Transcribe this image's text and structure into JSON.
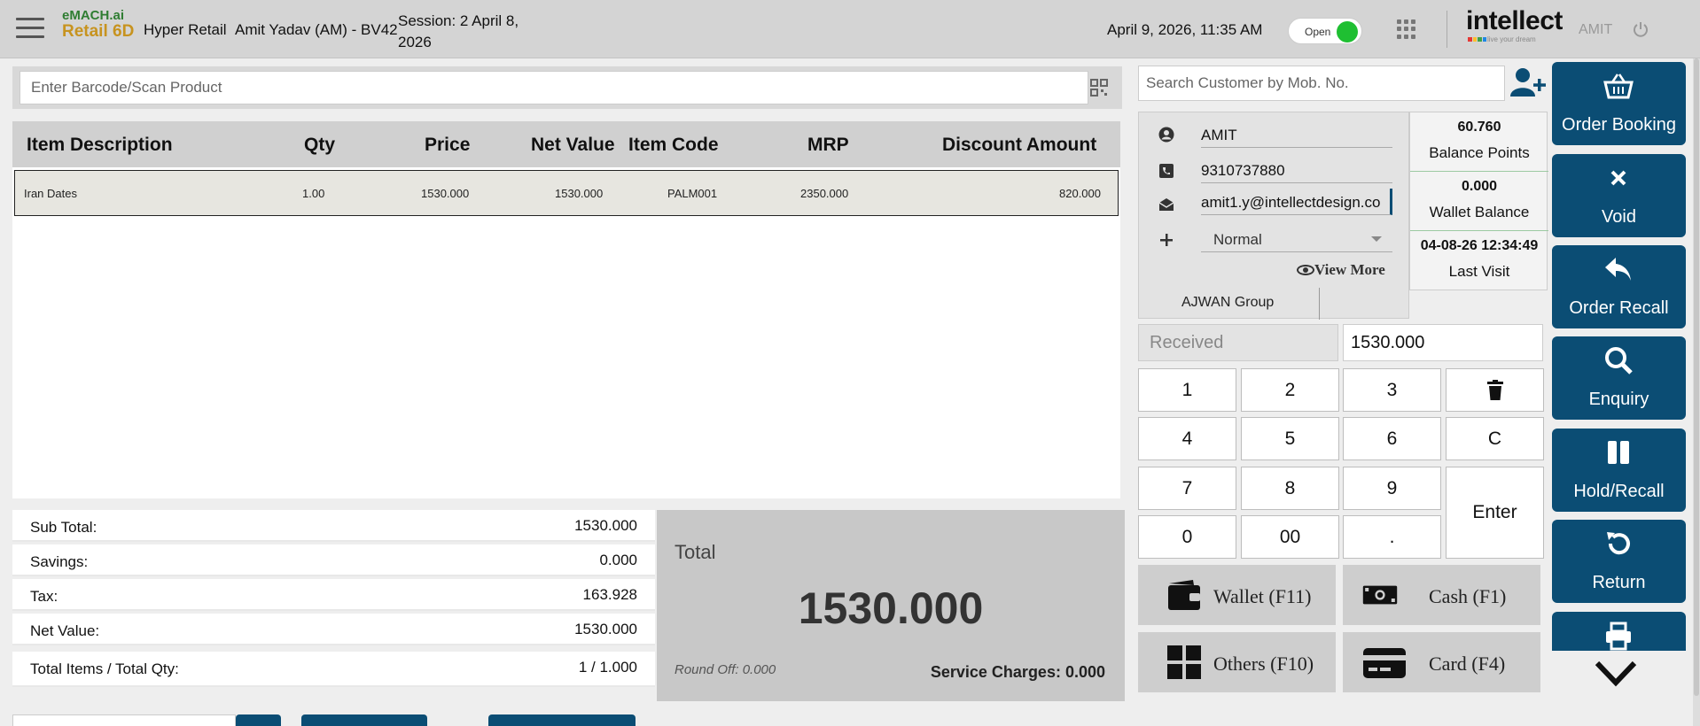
{
  "header": {
    "logo_top": "eMACH.ai",
    "logo_bottom": "Retail 6D",
    "store": "Hyper Retail",
    "user": "Amit Yadav (AM) - BV42",
    "session_line1": "Session: 2 April 8,",
    "session_line2": "2026",
    "datetime": "April 9, 2026, 11:35 AM",
    "toggle_label": "Open",
    "brand": "intellect",
    "brand_tagline": "live your dream",
    "user_short": "AMIT",
    "accent_green": "#1fbf32"
  },
  "scan": {
    "placeholder": "Enter Barcode/Scan Product"
  },
  "grid": {
    "headers": [
      "Item Description",
      "Qty",
      "Price",
      "Net Value",
      "Item Code",
      "MRP",
      "Discount Amount"
    ],
    "rows": [
      {
        "description": "Iran Dates",
        "qty": "1.00",
        "price": "1530.000",
        "net_value": "1530.000",
        "item_code": "PALM001",
        "mrp": "2350.000",
        "discount": "820.000"
      }
    ]
  },
  "totals": {
    "sub_total_label": "Sub Total:",
    "sub_total": "1530.000",
    "savings_label": "Savings:",
    "savings": "0.000",
    "tax_label": "Tax:",
    "tax": "163.928",
    "net_value_label": "Net Value:",
    "net_value": "1530.000",
    "items_label": "Total Items / Total Qty:",
    "items": "1 / 1.000",
    "total_label": "Total",
    "total": "1530.000",
    "round_off": "Round Off: 0.000",
    "service_charges": "Service Charges: 0.000"
  },
  "customer": {
    "search_placeholder": "Search Customer by Mob. No.",
    "name": "AMIT",
    "phone": "9310737880",
    "email": "amit1.y@intellectdesign.co",
    "type": "Normal",
    "view_more": "View More",
    "group": "AJWAN Group",
    "balance_points": "60.760",
    "balance_points_label": "Balance Points",
    "wallet_balance": "0.000",
    "wallet_balance_label": "Wallet Balance",
    "last_visit": "04-08-26 12:34:49",
    "last_visit_label": "Last Visit"
  },
  "payment": {
    "received_label": "Received",
    "received_value": "1530.000",
    "keys": [
      "1",
      "2",
      "3",
      "4",
      "5",
      "6",
      "C",
      "7",
      "8",
      "9",
      "Enter",
      "0",
      "00",
      "."
    ],
    "wallet": "Wallet (F11)",
    "cash": "Cash (F1)",
    "others": "Others (F10)",
    "card": "Card (F4)"
  },
  "actions": {
    "order_booking": "Order Booking",
    "void": "Void",
    "order_recall": "Order Recall",
    "enquiry": "Enquiry",
    "hold_recall": "Hold/Recall",
    "return": "Return",
    "primary_color": "#0b4d74"
  }
}
